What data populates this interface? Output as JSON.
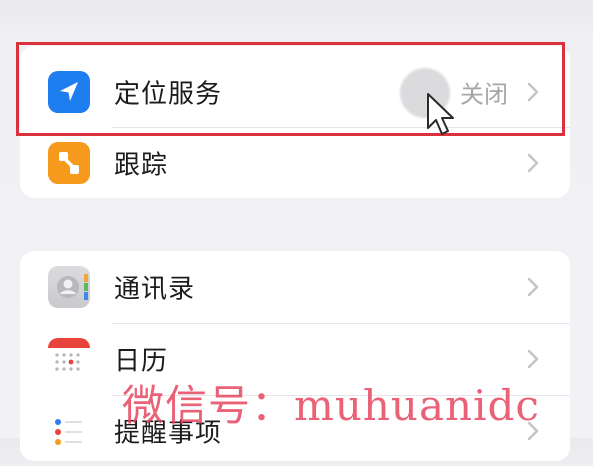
{
  "settings": {
    "group1": [
      {
        "label": "定位服务",
        "value": "关闭",
        "icon": "location-arrow-icon",
        "color": "#1e7ef0"
      },
      {
        "label": "跟踪",
        "value": "",
        "icon": "tracking-icon",
        "color": "#f59a1c"
      }
    ],
    "group2": [
      {
        "label": "通讯录",
        "value": "",
        "icon": "contacts-icon",
        "color": "#d1d1d6"
      },
      {
        "label": "日历",
        "value": "",
        "icon": "calendar-icon",
        "color": "#e8433a"
      },
      {
        "label": "提醒事项",
        "value": "",
        "icon": "reminders-icon",
        "color": "#2f7df6"
      }
    ]
  },
  "highlight_color": "#d9323d",
  "watermark": "微信号：muhuanidc"
}
